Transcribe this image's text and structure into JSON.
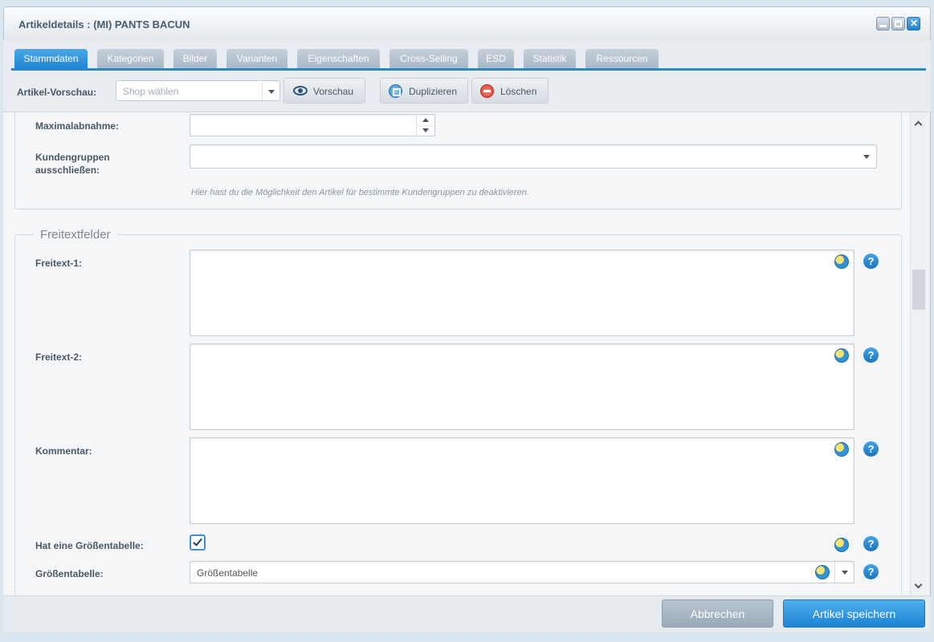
{
  "window": {
    "title": "Artikeldetails : (MI) PANTS BACUN",
    "controls": [
      "minimize-icon",
      "maximize-icon",
      "close-icon"
    ]
  },
  "tabs": [
    {
      "label": "Stammdaten",
      "active": true
    },
    {
      "label": "Kategorien",
      "active": false
    },
    {
      "label": "Bilder",
      "active": false
    },
    {
      "label": "Varianten",
      "active": false
    },
    {
      "label": "Eigenschaften",
      "active": false
    },
    {
      "label": "Cross-Selling",
      "active": false
    },
    {
      "label": "ESD",
      "active": false
    },
    {
      "label": "Statistik",
      "active": false
    },
    {
      "label": "Ressourcen",
      "active": false
    }
  ],
  "toolbar": {
    "preview_label": "Artikel-Vorschau:",
    "shop_placeholder": "Shop wählen",
    "preview_button": "Vorschau",
    "duplicate_button": "Duplizieren",
    "delete_button": "Löschen"
  },
  "fields": {
    "max_purchase": {
      "label": "Maximalabnahme:",
      "value": ""
    },
    "exclude_groups": {
      "label_line1": "Kundengruppen",
      "label_line2": "ausschließen:",
      "value": ""
    },
    "exclude_groups_hint": "Hier hast du die Möglichkeit den Artikel für bestimmte Kundengruppen zu deaktivieren."
  },
  "freetext": {
    "legend": "Freitextfelder",
    "freitext1": {
      "label": "Freitext-1:",
      "value": ""
    },
    "freitext2": {
      "label": "Freitext-2:",
      "value": ""
    },
    "comment": {
      "label": "Kommentar:",
      "value": ""
    },
    "has_size_table": {
      "label": "Hat eine Größentabelle:",
      "checked": true
    },
    "size_table": {
      "label": "Größentabelle:",
      "value": "Größentabelle"
    },
    "help_glyph": "?"
  },
  "footer": {
    "cancel": "Abbrechen",
    "save": "Artikel speichern"
  },
  "colors": {
    "accent": "#1e8ad6",
    "tab_inactive": "#aab8c6",
    "cancel_button": "#9aaab9",
    "save_button": "#1b83d3"
  }
}
